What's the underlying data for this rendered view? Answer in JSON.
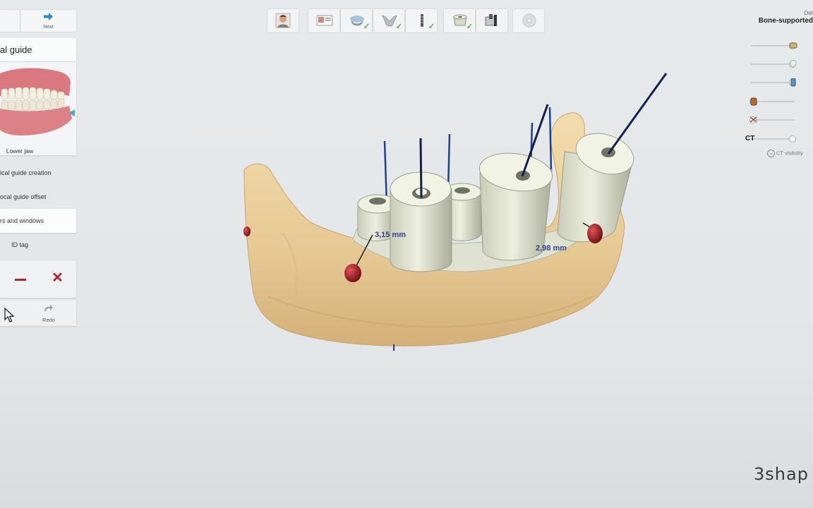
{
  "left_panel": {
    "next_label": "Next",
    "title": "al guide",
    "jaw_label": "Lower jaw",
    "steps": [
      "ical guide creation",
      "ocal guide offset",
      "rs and windows",
      "ID tag"
    ],
    "redo_label": "Redo"
  },
  "toolbar": {
    "tools": [
      {
        "icon": "patient-icon",
        "done": false
      },
      {
        "icon": "scan-import-icon",
        "done": false
      },
      {
        "icon": "ct-alignment-icon",
        "done": true
      },
      {
        "icon": "jaw-segmentation-icon",
        "done": true
      },
      {
        "icon": "implant-planning-icon",
        "done": true
      },
      {
        "icon": "sleeve-icon",
        "done": true
      },
      {
        "icon": "guide-design-icon",
        "done": false
      },
      {
        "icon": "export-icon",
        "done": false
      }
    ],
    "check_glyph": "✓"
  },
  "right_panel": {
    "line1": "Det",
    "line2": "Bone-supported",
    "ct_label": "CT",
    "ct_visibility_label": "CT visibility",
    "slider_icons": [
      "guide-visibility-icon",
      "tooth-visibility-icon",
      "implant-visibility-icon",
      "sleeve-visibility-icon",
      "cut-visibility-icon",
      "ct-visibility-icon"
    ],
    "slider_levels": [
      1.0,
      1.0,
      1.0,
      0.0,
      0.0,
      1.0
    ]
  },
  "viewport": {
    "measurements": [
      "3,15 mm",
      "2,98 mm"
    ]
  },
  "brand": "3shap",
  "colors": {
    "bone": "#e8cf9f",
    "guide": "#dfe2d0",
    "pin": "#9b1a1f",
    "check": "#4bb34b",
    "accent_red": "#b0242f"
  }
}
